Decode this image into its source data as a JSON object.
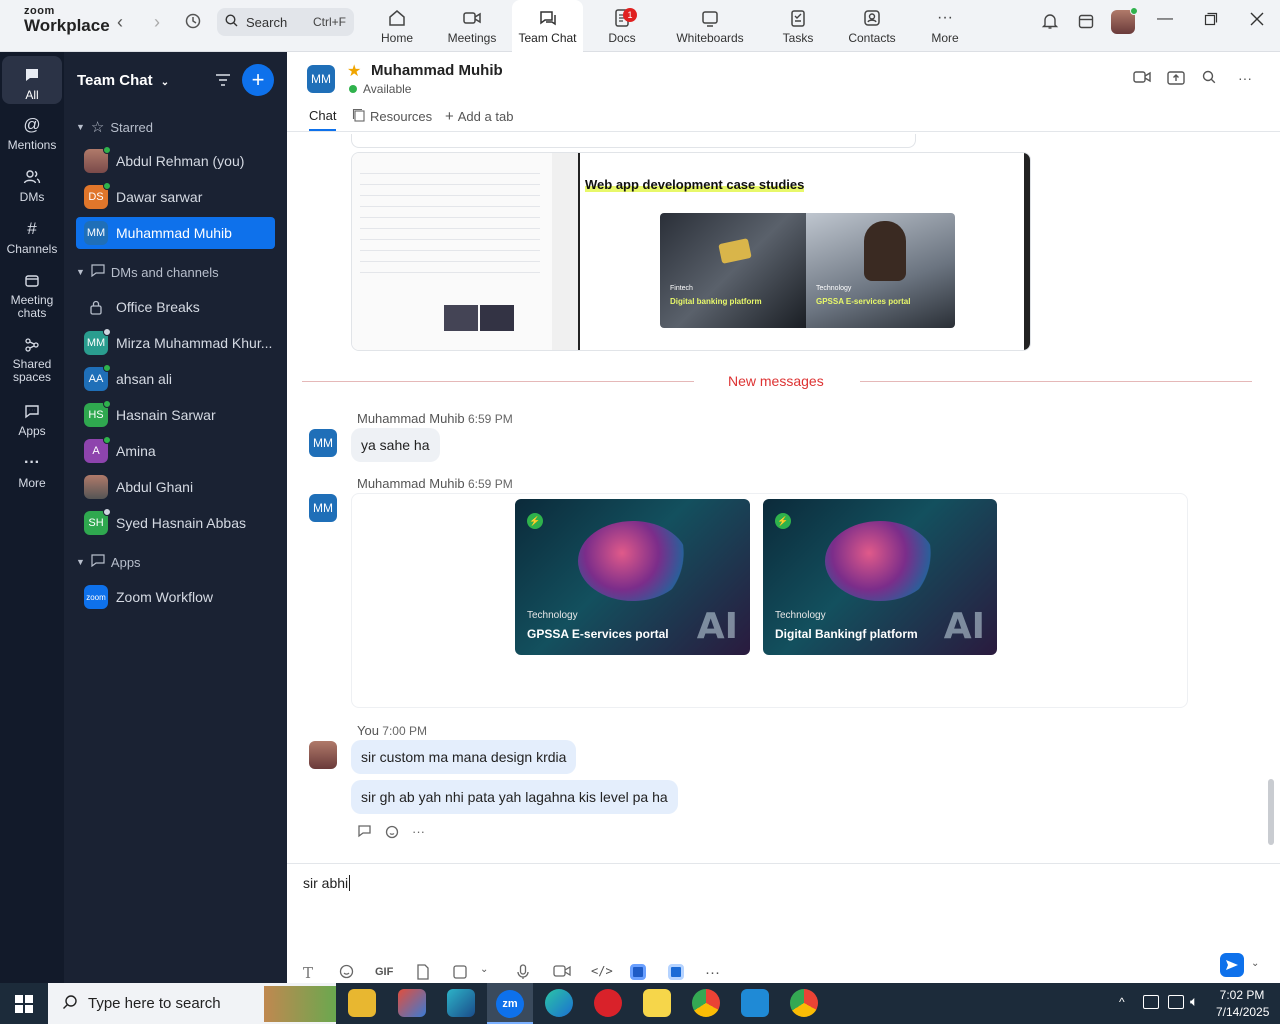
{
  "app": {
    "logo_line1": "zoom",
    "logo_line2": "Workplace"
  },
  "search": {
    "label": "Search",
    "shortcut": "Ctrl+F"
  },
  "tabs": [
    {
      "label": "Home"
    },
    {
      "label": "Meetings"
    },
    {
      "label": "Team Chat"
    },
    {
      "label": "Docs",
      "badge": "1"
    },
    {
      "label": "Whiteboards"
    },
    {
      "label": "Tasks"
    },
    {
      "label": "Contacts"
    },
    {
      "label": "More"
    }
  ],
  "rail": [
    {
      "label": "All"
    },
    {
      "label": "Mentions"
    },
    {
      "label": "DMs"
    },
    {
      "label": "Channels"
    },
    {
      "label": "Meeting chats"
    },
    {
      "label": "Shared spaces"
    },
    {
      "label": "Apps"
    },
    {
      "label": "More"
    }
  ],
  "sidebar": {
    "title": "Team Chat",
    "starred_label": "Starred",
    "starred": [
      {
        "name": "Abdul Rehman (you)",
        "initials": "",
        "color": "#7a4a4a",
        "status": "#2fb24c"
      },
      {
        "name": "Dawar sarwar",
        "initials": "DS",
        "color": "#e0762b",
        "status": "#2fb24c"
      },
      {
        "name": "Muhammad Muhib",
        "initials": "MM",
        "color": "#1f6fb8",
        "status": ""
      }
    ],
    "dms_label": "DMs and channels",
    "dms": [
      {
        "name": "Office Breaks",
        "initials": "",
        "color": "",
        "status": ""
      },
      {
        "name": "Mirza Muhammad Khur...",
        "initials": "MM",
        "color": "#2a9d8f",
        "status": "#cfd6e0"
      },
      {
        "name": "ahsan ali",
        "initials": "AA",
        "color": "#1f6fb8",
        "status": "#2fb24c"
      },
      {
        "name": "Hasnain Sarwar",
        "initials": "HS",
        "color": "#2fa84f",
        "status": "#2fb24c"
      },
      {
        "name": "Amina",
        "initials": "A",
        "color": "#8e44ad",
        "status": "#2fb24c"
      },
      {
        "name": "Abdul Ghani",
        "initials": "",
        "color": "#555",
        "status": ""
      },
      {
        "name": "Syed Hasnain Abbas",
        "initials": "SH",
        "color": "#2fa84f",
        "status": "#cfd6e0"
      }
    ],
    "apps_label": "Apps",
    "apps": [
      {
        "name": "Zoom Workflow",
        "initials": "zoom",
        "color": "#0e71eb",
        "status": ""
      }
    ]
  },
  "chat": {
    "contact_initials": "MM",
    "contact_name": "Muhammad Muhib",
    "status": "Available",
    "subtabs": [
      "Chat",
      "Resources",
      "Add a tab"
    ],
    "preview_heading": "Web app development case studies",
    "preview_cards": [
      {
        "category": "Fintech",
        "title": "Digital banking platform"
      },
      {
        "category": "Technology",
        "title": "GPSSA E-services portal"
      }
    ],
    "divider": "New messages",
    "messages": [
      {
        "sender": "Muhammad Muhib",
        "time": "6:59 PM",
        "text": "ya sahe ha"
      },
      {
        "sender": "Muhammad Muhib",
        "time": "6:59 PM",
        "cards": [
          {
            "category": "Technology",
            "title": "GPSSA E-services portal"
          },
          {
            "category": "Technology",
            "title": "Digital Bankingf platform"
          }
        ]
      },
      {
        "sender": "You",
        "time": "7:00 PM",
        "texts": [
          "sir custom ma mana design krdia",
          "sir gh ab yah nhi pata yah lagahna kis level pa ha"
        ]
      }
    ],
    "composer_text": "sir abhi",
    "gif_label": "GIF"
  },
  "taskbar": {
    "search_placeholder": "Type here to search",
    "time": "7:02 PM",
    "date": "7/14/2025"
  }
}
